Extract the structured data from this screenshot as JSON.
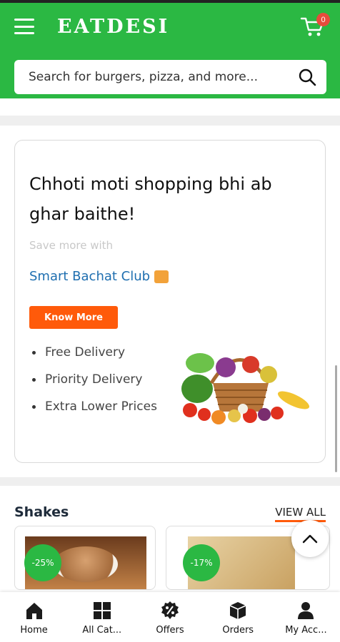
{
  "header": {
    "logo": "EATDESI",
    "cart_count": "0",
    "search_placeholder": "Search for burgers, pizza, and more..."
  },
  "promo": {
    "title": "Chhoti moti shopping bhi ab ghar baithe!",
    "subtitle": "Save more with",
    "club_name": "Smart Bachat Club",
    "button_label": "Know More",
    "benefits": [
      "Free Delivery",
      "Priority Delivery",
      "Extra Lower Prices"
    ]
  },
  "section": {
    "title": "Shakes",
    "view_all": "VIEW ALL"
  },
  "products": [
    {
      "discount": "-25%"
    },
    {
      "discount": "-17%"
    }
  ],
  "nav": [
    {
      "label": "Home",
      "icon": "home-icon"
    },
    {
      "label": "All Cat...",
      "icon": "grid-icon"
    },
    {
      "label": "Offers",
      "icon": "offer-icon"
    },
    {
      "label": "Orders",
      "icon": "box-icon"
    },
    {
      "label": "My Acc...",
      "icon": "user-icon"
    }
  ],
  "colors": {
    "brand_green": "#2bb843",
    "accent_orange": "#ff5a0a",
    "link_blue": "#1f6fb0"
  }
}
